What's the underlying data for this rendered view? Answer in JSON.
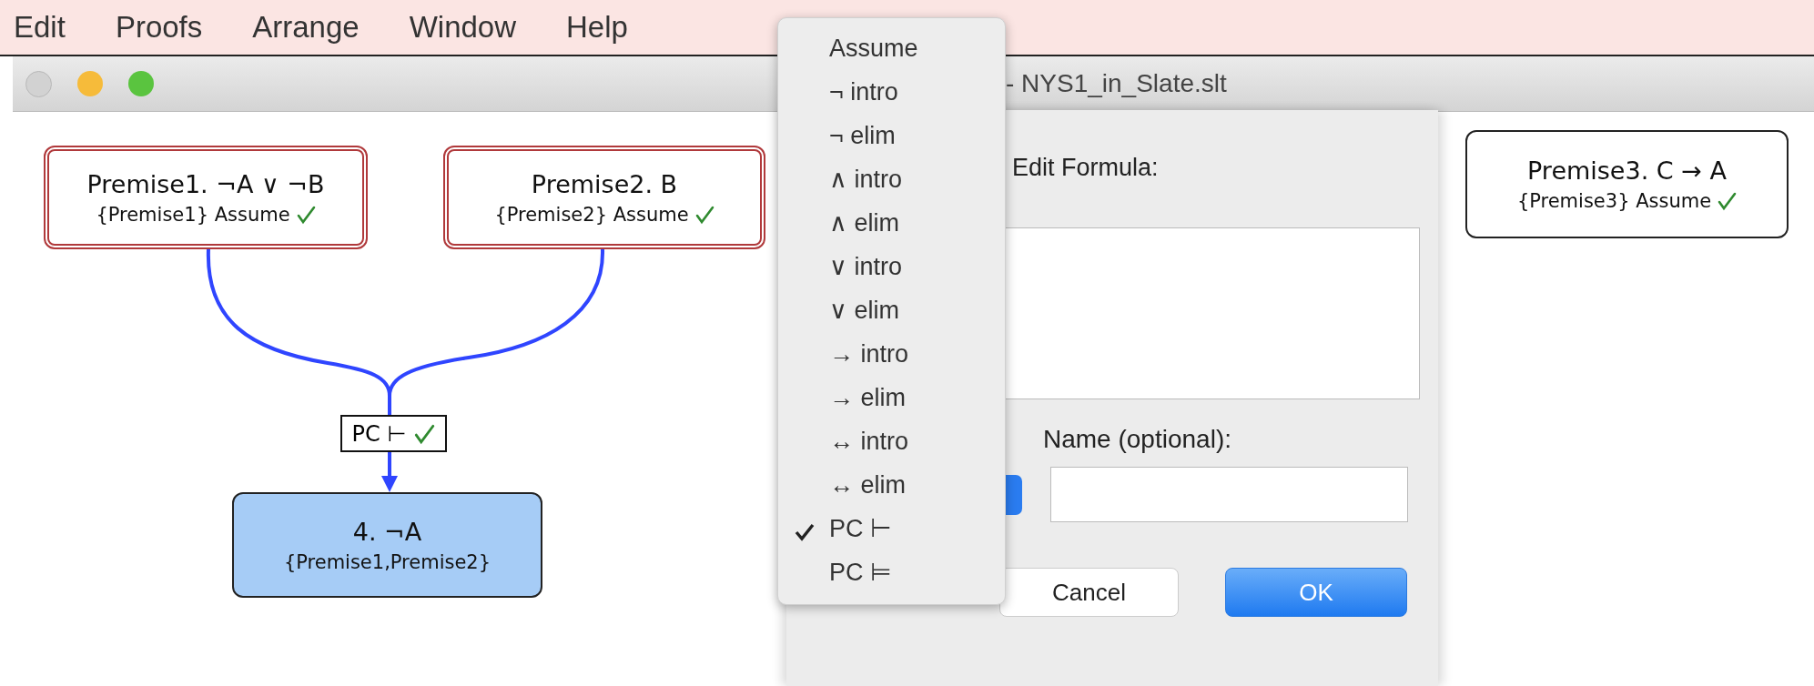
{
  "menu_bar": {
    "items": [
      "Edit",
      "Proofs",
      "Arrange",
      "Window",
      "Help"
    ]
  },
  "window": {
    "title": "- NYS1_in_Slate.slt"
  },
  "nodes": [
    {
      "label": "Premise1. ¬A ∨ ¬B",
      "support": "{Premise1} Assume",
      "valid": true,
      "emphasized": true,
      "selected": false
    },
    {
      "label": "Premise2. B",
      "support": "{Premise2} Assume",
      "valid": true,
      "emphasized": true,
      "selected": false
    },
    {
      "label": "Premise3. C → A",
      "support": "{Premise3} Assume",
      "valid": true,
      "emphasized": false,
      "selected": false
    },
    {
      "label": "4. ¬A",
      "support": "{Premise1,Premise2}",
      "valid": false,
      "emphasized": false,
      "selected": true
    }
  ],
  "justification": {
    "label": "PC ⊢",
    "valid": true
  },
  "dialog": {
    "heading": "Edit Formula:",
    "name_label": "Name (optional):",
    "buttons": [
      {
        "label": "Cancel",
        "default": false
      },
      {
        "label": "OK",
        "default": true
      }
    ]
  },
  "rule_menu": {
    "items": [
      {
        "label": "Assume",
        "selected": false
      },
      {
        "label": "¬ intro",
        "selected": false
      },
      {
        "label": "¬ elim",
        "selected": false
      },
      {
        "label": "∧ intro",
        "selected": false
      },
      {
        "label": "∧ elim",
        "selected": false
      },
      {
        "label": "∨ intro",
        "selected": false
      },
      {
        "label": "∨ elim",
        "selected": false
      },
      {
        "label": "→ intro",
        "selected": false
      },
      {
        "label": "→ elim",
        "selected": false
      },
      {
        "label": "↔ intro",
        "selected": false
      },
      {
        "label": "↔ elim",
        "selected": false
      },
      {
        "label": "PC ⊢",
        "selected": true
      },
      {
        "label": "PC ⊨",
        "selected": false
      }
    ]
  }
}
